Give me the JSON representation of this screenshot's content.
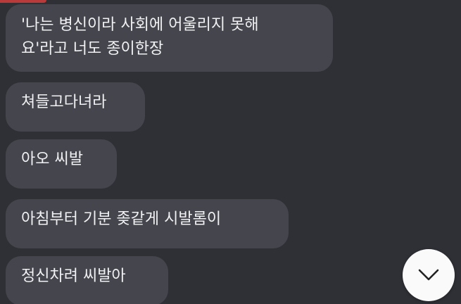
{
  "messages": [
    {
      "lines": [
        "'나는 병신이라 사회에 어울리지 못해",
        "요'라고 너도 종이한장"
      ]
    },
    {
      "lines": [
        "쳐들고다녀라"
      ]
    },
    {
      "lines": [
        "아오 씨발"
      ]
    },
    {
      "lines": [
        "아침부터 기분 좆같게 시발롬이"
      ]
    },
    {
      "lines": [
        "정신차려 씨발아"
      ]
    }
  ],
  "scroll_button": {
    "icon": "chevron-down-icon"
  },
  "colors": {
    "background": "#2f3036",
    "bubble": "#45464d",
    "text": "#f1f1f3",
    "accent": "#b83a3a",
    "button": "#fafafa"
  }
}
